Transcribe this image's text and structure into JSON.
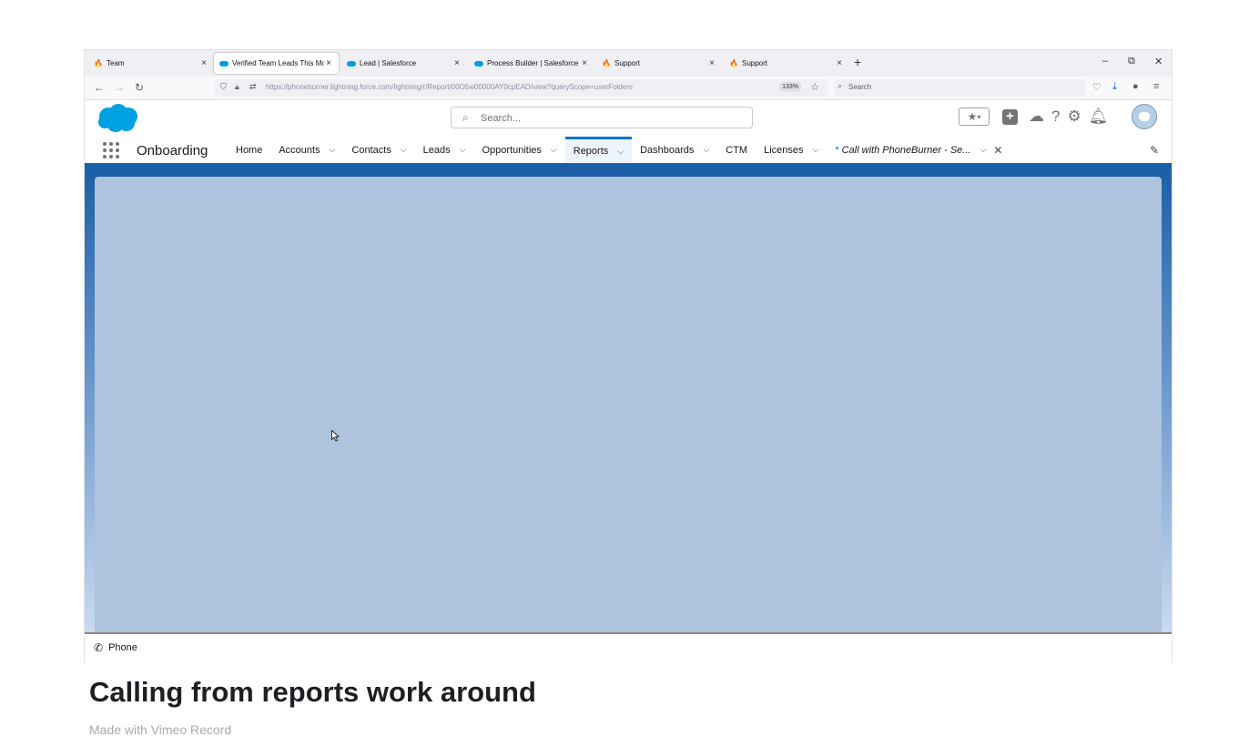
{
  "browser": {
    "tabs": [
      {
        "label": "Team",
        "icon": "flame-icon",
        "active": false
      },
      {
        "label": "Verified Team Leads This Month",
        "icon": "salesforce-icon",
        "active": true
      },
      {
        "label": "Lead | Salesforce",
        "icon": "salesforce-icon",
        "active": false
      },
      {
        "label": "Process Builder | Salesforce",
        "icon": "salesforce-icon",
        "active": false
      },
      {
        "label": "Support",
        "icon": "flame-icon",
        "active": false
      },
      {
        "label": "Support",
        "icon": "flame-icon",
        "active": false
      }
    ],
    "url": "https://phoneburner.lightning.force.com/lightning/r/Report/00O5w00000AY0cpEAD/view?queryScope=userFolders",
    "zoom": "133%",
    "search_placeholder": "Search"
  },
  "salesforce": {
    "search_placeholder": "Search...",
    "app_name": "Onboarding",
    "nav": [
      {
        "label": "Home",
        "dropdown": false,
        "active": false
      },
      {
        "label": "Accounts",
        "dropdown": true,
        "active": false
      },
      {
        "label": "Contacts",
        "dropdown": true,
        "active": false
      },
      {
        "label": "Leads",
        "dropdown": true,
        "active": false
      },
      {
        "label": "Opportunities",
        "dropdown": true,
        "active": false
      },
      {
        "label": "Reports",
        "dropdown": true,
        "active": true
      },
      {
        "label": "Dashboards",
        "dropdown": true,
        "active": false
      },
      {
        "label": "CTM",
        "dropdown": false,
        "active": false
      },
      {
        "label": "Licenses",
        "dropdown": true,
        "active": false
      }
    ],
    "workspace_tab": {
      "label": "Call with PhoneBurner - Se...",
      "marker": "*"
    },
    "utility_bar": {
      "phone_label": "Phone"
    }
  },
  "document": {
    "title": "Calling from reports work around",
    "subline": "Made with Vimeo Record"
  },
  "colors": {
    "brand": "#00a1e0",
    "nav_active": "#0176d3",
    "loading_panel": "#adc3de"
  }
}
